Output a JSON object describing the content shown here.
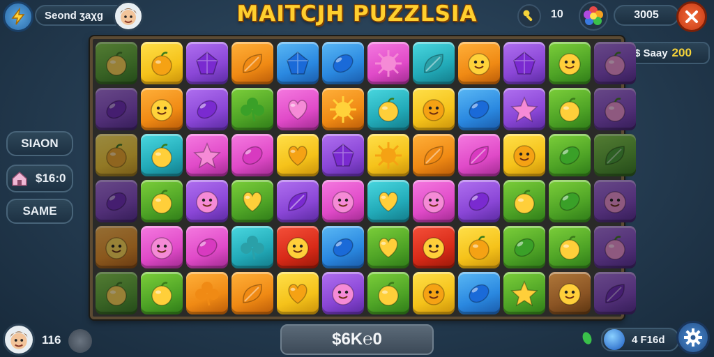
{
  "header": {
    "title": "MAITCJH PUZZLSIA",
    "player_label": "Seond ʒaχg",
    "moves_value": "10",
    "score_value": "3005"
  },
  "sidebar": {
    "season_label": "SΙΑΟΝ",
    "money_value": "$16:0",
    "game_label": "SAME"
  },
  "right_panel": {
    "currency_label": "$ Saay",
    "currency_value": "200"
  },
  "footer": {
    "level_value": "116",
    "center_value": "$6K℮0",
    "gems_label": "4 F16d"
  },
  "icons": {
    "lightning": "lightning-icon",
    "avatar": "avatar-icon",
    "key": "key-icon",
    "flower": "flower-icon",
    "close": "close-icon",
    "house": "house-icon",
    "gear": "gear-icon",
    "orb": "orb-icon"
  },
  "colors": {
    "title": "#ffcf2e",
    "close_button": "#e04a1c",
    "accent_yellow": "#f5d33a"
  },
  "board": {
    "rows": 6,
    "cols": 12,
    "tiles": [
      [
        "green:fruit:dim",
        "yellow:fruit",
        "purple:gem",
        "orange:leaf",
        "blue:gem",
        "blue:bean",
        "pink:sun",
        "teal:leaf",
        "orange:face",
        "purple:gem",
        "green:face",
        "purple:fruit:dim"
      ],
      [
        "purple:bean:dim",
        "orange:face",
        "purple:bean",
        "green:clover",
        "pink:heart",
        "orange:sun",
        "teal:fruit",
        "yellow:face",
        "blue:bean",
        "purple:star",
        "green:fruit",
        "purple:fruit:dim"
      ],
      [
        "yellow:fruit:dim",
        "teal:fruit",
        "pink:star",
        "pink:bean",
        "yellow:heart",
        "purple:gem",
        "yellow:sun",
        "orange:leaf",
        "pink:leaf",
        "yellow:face",
        "green:bean",
        "green:leaf:dim"
      ],
      [
        "purple:bean:dim",
        "green:fruit",
        "purple:face",
        "green:heart",
        "purple:leaf",
        "pink:face",
        "teal:heart",
        "pink:face",
        "purple:bean",
        "green:fruit",
        "green:bean",
        "purple:face:dim"
      ],
      [
        "orange:face:dim",
        "pink:face",
        "pink:bean",
        "teal:clover",
        "red:face",
        "blue:bean",
        "green:heart",
        "red:face",
        "yellow:fruit",
        "green:bean",
        "green:fruit",
        "purple:fruit:dim"
      ],
      [
        "green:fruit:dim",
        "green:fruit",
        "orange:clover",
        "orange:leaf",
        "yellow:heart",
        "purple:face",
        "green:fruit",
        "yellow:face",
        "blue:bean",
        "green:star",
        "brown:face",
        "purple:leaf:dim"
      ]
    ]
  }
}
